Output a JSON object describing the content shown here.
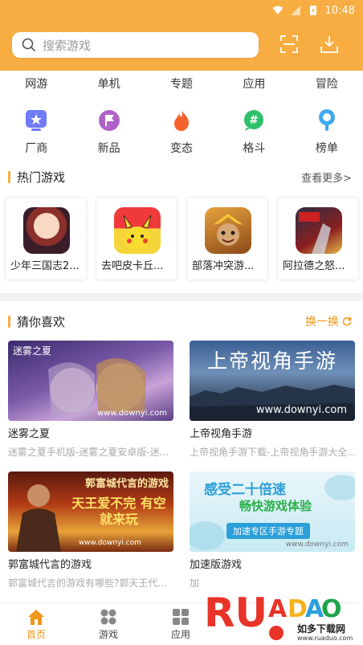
{
  "status_bar": {
    "time": "10:48"
  },
  "search": {
    "placeholder": "搜索游戏"
  },
  "tabs": [
    "网游",
    "单机",
    "专题",
    "应用",
    "冒险"
  ],
  "categories": [
    {
      "label": "厂商",
      "icon": "star-badge-icon",
      "color": "#6f7bf7"
    },
    {
      "label": "新品",
      "icon": "flag-circle-icon",
      "color": "#b062c8"
    },
    {
      "label": "变态",
      "icon": "flame-icon",
      "color": "#f5622d"
    },
    {
      "label": "格斗",
      "icon": "hash-bubble-icon",
      "color": "#2ec06a"
    },
    {
      "label": "榜单",
      "icon": "medal-icon",
      "color": "#3ea8f0"
    }
  ],
  "hot_section": {
    "title": "热门游戏",
    "more": "查看更多>"
  },
  "hot_games": [
    {
      "name": "少年三国志2..."
    },
    {
      "name": "去吧皮卡丘..."
    },
    {
      "name": "部落冲突游..."
    },
    {
      "name": "阿拉德之怒..."
    }
  ],
  "guess_section": {
    "title": "猜你喜欢",
    "refresh": "换一换"
  },
  "guess_items": [
    {
      "title": "迷雾之夏",
      "desc": "迷雾之夏手机版-迷雾之夏安卓版-迷...",
      "banner": "迷雾之夏",
      "site": "www.downyi.com"
    },
    {
      "title": "上帝视角手游",
      "desc": "上帝视角手游下载-上帝视角手游大全...",
      "banner": "上帝视角手游",
      "site": "www.downyi.com"
    },
    {
      "title": "郭富城代言的游戏",
      "desc": "郭富城代言的游戏有哪些?郭天王代...",
      "banner": "郭富城代言的游戏",
      "banner2": "天王爱不完 有空就来玩",
      "site": "www.downyi.com"
    },
    {
      "title": "加速版游戏",
      "desc": "加",
      "banner": "感受二十倍速",
      "banner2": "畅快游戏体验",
      "banner3": "加速专区手游专题",
      "site": "www.downyi.com"
    }
  ],
  "bottom_nav": [
    {
      "label": "首页",
      "active": true
    },
    {
      "label": "游戏",
      "active": false
    },
    {
      "label": "应用",
      "active": false
    }
  ],
  "watermark": {
    "brand": "RUANDAO",
    "sub": "如多下载网",
    "url": "www.ruaduo.com"
  },
  "accent": "#f8ad42"
}
